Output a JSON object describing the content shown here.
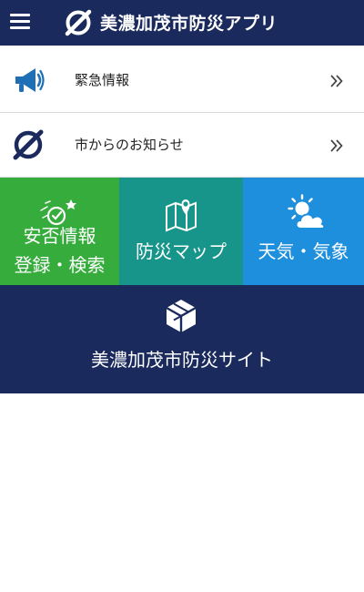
{
  "header": {
    "title": "美濃加茂市防災アプリ",
    "menu_icon": "hamburger-menu-icon",
    "logo_icon": "city-logo-icon",
    "background": "#1b2a5c"
  },
  "list": [
    {
      "label": "緊急情報",
      "icon": "megaphone-icon",
      "chevron": "double-chevron-right-icon"
    },
    {
      "label": "市からのお知らせ",
      "icon": "city-logo-icon",
      "chevron": "double-chevron-right-icon"
    }
  ],
  "tiles": [
    {
      "lines": [
        "安否情報",
        "登録・検索"
      ],
      "icon": "safety-confirmation-icon",
      "color": "#35ac3b"
    },
    {
      "lines": [
        "防災マップ"
      ],
      "icon": "map-pin-icon",
      "color": "#17958a"
    },
    {
      "lines": [
        "天気・気象"
      ],
      "icon": "sun-cloud-icon",
      "color": "#1d8fdd"
    }
  ],
  "banner": {
    "label": "美濃加茂市防災サイト",
    "icon": "disaster-site-logo-icon",
    "color": "#1b2a5c"
  }
}
